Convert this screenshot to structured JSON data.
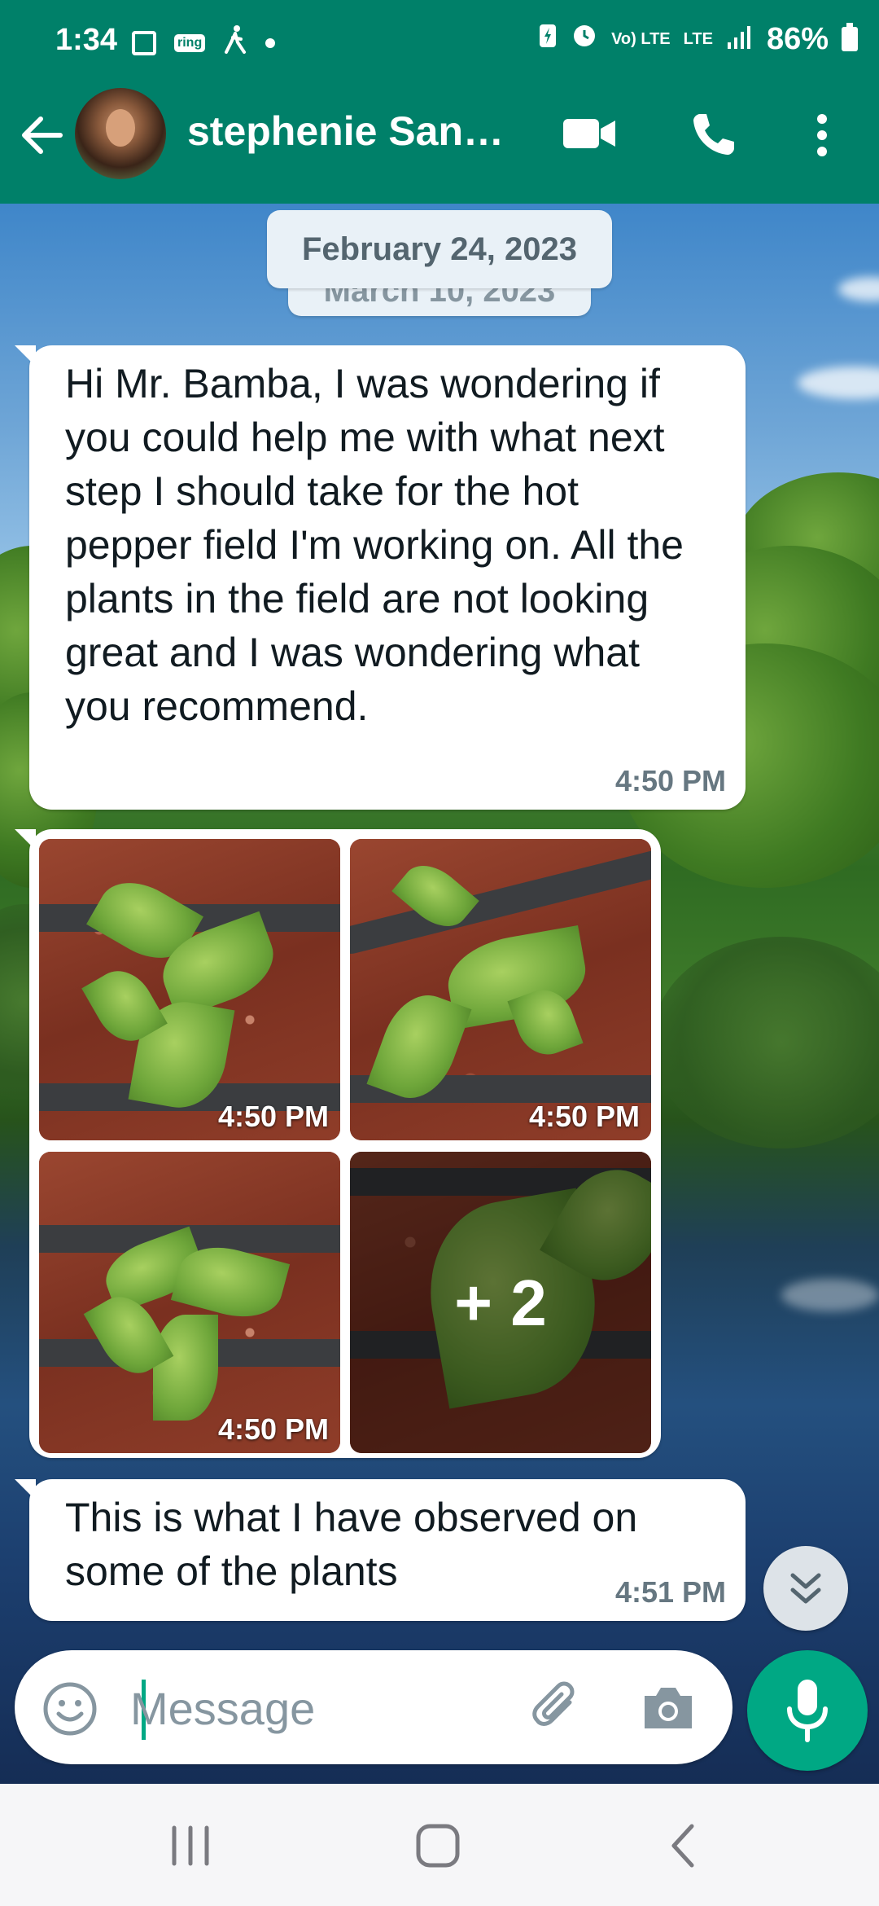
{
  "status_bar": {
    "time": "1:34",
    "ring_label": "ring",
    "volte_label": "Vo) LTE",
    "lte_label": "LTE",
    "battery": "86%"
  },
  "header": {
    "contact_name": "stephenie San…",
    "icons": [
      "back-arrow-icon",
      "avatar",
      "video-call-icon",
      "phone-icon",
      "more-vert-icon"
    ]
  },
  "chat": {
    "date_chips": [
      "February 24, 2023",
      "March 10, 2023"
    ],
    "messages": [
      {
        "type": "text",
        "text": "Hi Mr. Bamba, I was wondering if you could help me with what next step I should take for the hot pepper field I'm working on. All the plants in the field are not looking great and I was wondering what you recommend.",
        "time": "4:50 PM"
      },
      {
        "type": "photo_album",
        "photos": [
          {
            "time": "4:50 PM"
          },
          {
            "time": "4:50 PM"
          },
          {
            "time": "4:50 PM"
          },
          {
            "more_label": "+ 2"
          }
        ]
      },
      {
        "type": "text",
        "text": "This is what I have observed on some of the plants",
        "time": "4:51 PM"
      }
    ]
  },
  "composer": {
    "placeholder": "Message",
    "icons": [
      "emoji-icon",
      "attach-icon",
      "camera-icon",
      "mic-icon"
    ]
  },
  "colors": {
    "header_green": "#008069",
    "accent_green": "#00a884",
    "bubble": "#ffffff"
  }
}
